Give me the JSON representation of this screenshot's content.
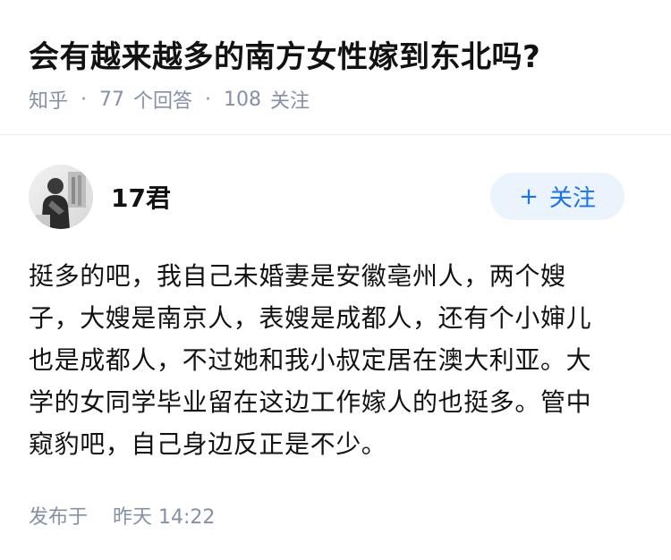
{
  "question": {
    "title": "会有越来越多的南方女性嫁到东北吗?",
    "source": "知乎",
    "separator": "·",
    "answers_count": "77",
    "answers_label": "个回答",
    "followers_count": "108",
    "followers_label": "关注"
  },
  "author": {
    "name": "17君",
    "follow_plus": "+",
    "follow_label": "关注"
  },
  "answer": {
    "lines": [
      "挺多的吧，我自己未婚妻是安徽亳州人，两个嫂",
      "子，大嫂是南京人，表嫂是成都人，还有个小婶儿",
      "也是成都人，不过她和我小叔定居在澳大利亚。大",
      "学的女同学毕业留在这边工作嫁人的也挺多。管中",
      "窥豹吧，自己身边反正是不少。"
    ]
  },
  "publish": {
    "label": "发布于",
    "time": "昨天 14:22"
  },
  "colors": {
    "meta_gray": "#8590a6",
    "accent_blue": "#1772f6",
    "follow_bg": "#ebf3fc",
    "text": "#121212"
  },
  "icons": {
    "follow": "plus-icon"
  }
}
